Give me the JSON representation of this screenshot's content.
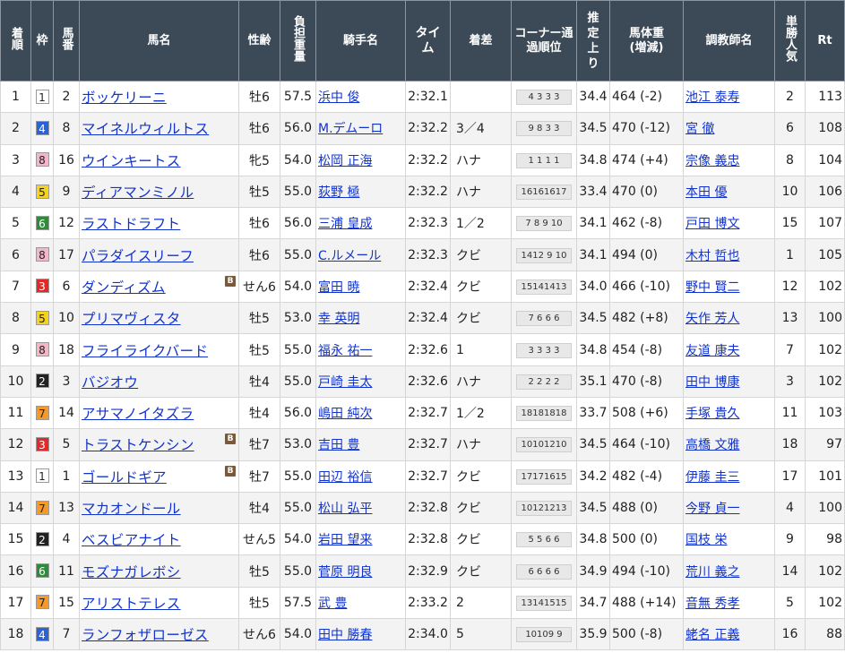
{
  "headers": {
    "rank": "着順",
    "waku": "枠",
    "umaban": "馬番",
    "horse": "馬名",
    "sexage": "性齢",
    "weight": "負担重量",
    "jockey": "騎手名",
    "time": "タイム",
    "margin": "着差",
    "corner": "コーナー通過順位",
    "last3f": "推定上り",
    "body": "馬体重(増減)",
    "trainer": "調教師名",
    "pop": "単勝人気",
    "rt": "Rt"
  },
  "blinker_label": "B",
  "waku_colors": {
    "1": {
      "bg": "#ffffff",
      "fg": "#222222"
    },
    "2": {
      "bg": "#222222",
      "fg": "#ffffff"
    },
    "3": {
      "bg": "#e02a2a",
      "fg": "#ffffff"
    },
    "4": {
      "bg": "#2a62d8",
      "fg": "#ffffff"
    },
    "5": {
      "bg": "#f5d21c",
      "fg": "#222222"
    },
    "6": {
      "bg": "#2e8b3a",
      "fg": "#ffffff"
    },
    "7": {
      "bg": "#f59a2a",
      "fg": "#222222"
    },
    "8": {
      "bg": "#f7b6c8",
      "fg": "#222222"
    }
  },
  "rows": [
    {
      "rank": "1",
      "waku": "1",
      "umaban": "2",
      "horse": "ボッケリーニ",
      "blinker": false,
      "sexage": "牡6",
      "weight": "57.5",
      "jockey": "浜中 俊",
      "time": "2:32.1",
      "margin": "",
      "corner": "4 3 3 3",
      "last3f": "34.4",
      "body": "464 (-2)",
      "trainer": "池江 泰寿",
      "pop": "2",
      "rt": "113"
    },
    {
      "rank": "2",
      "waku": "4",
      "umaban": "8",
      "horse": "マイネルウィルトス",
      "blinker": false,
      "sexage": "牡6",
      "weight": "56.0",
      "jockey": "M.デムーロ",
      "time": "2:32.2",
      "margin": "3／4",
      "corner": "9 8 3 3",
      "last3f": "34.5",
      "body": "470 (-12)",
      "trainer": "宮 徹",
      "pop": "6",
      "rt": "108"
    },
    {
      "rank": "3",
      "waku": "8",
      "umaban": "16",
      "horse": "ウインキートス",
      "blinker": false,
      "sexage": "牝5",
      "weight": "54.0",
      "jockey": "松岡 正海",
      "time": "2:32.2",
      "margin": "ハナ",
      "corner": "1 1 1 1",
      "last3f": "34.8",
      "body": "474 (+4)",
      "trainer": "宗像 義忠",
      "pop": "8",
      "rt": "104"
    },
    {
      "rank": "4",
      "waku": "5",
      "umaban": "9",
      "horse": "ディアマンミノル",
      "blinker": false,
      "sexage": "牡5",
      "weight": "55.0",
      "jockey": "荻野 極",
      "time": "2:32.2",
      "margin": "ハナ",
      "corner": "16161617",
      "last3f": "33.4",
      "body": "470 (0)",
      "trainer": "本田 優",
      "pop": "10",
      "rt": "106"
    },
    {
      "rank": "5",
      "waku": "6",
      "umaban": "12",
      "horse": "ラストドラフト",
      "blinker": false,
      "sexage": "牡6",
      "weight": "56.0",
      "jockey": "三浦 皇成",
      "time": "2:32.3",
      "margin": "1／2",
      "corner": "7 8 9 10",
      "last3f": "34.1",
      "body": "462 (-8)",
      "trainer": "戸田 博文",
      "pop": "15",
      "rt": "107"
    },
    {
      "rank": "6",
      "waku": "8",
      "umaban": "17",
      "horse": "パラダイスリーフ",
      "blinker": false,
      "sexage": "牡6",
      "weight": "55.0",
      "jockey": "C.ルメール",
      "time": "2:32.3",
      "margin": "クビ",
      "corner": "1412 9 10",
      "last3f": "34.1",
      "body": "494 (0)",
      "trainer": "木村 哲也",
      "pop": "1",
      "rt": "105"
    },
    {
      "rank": "7",
      "waku": "3",
      "umaban": "6",
      "horse": "ダンディズム",
      "blinker": true,
      "sexage": "せん6",
      "weight": "54.0",
      "jockey": "富田 暁",
      "time": "2:32.4",
      "margin": "クビ",
      "corner": "15141413",
      "last3f": "34.0",
      "body": "466 (-10)",
      "trainer": "野中 賢二",
      "pop": "12",
      "rt": "102"
    },
    {
      "rank": "8",
      "waku": "5",
      "umaban": "10",
      "horse": "プリマヴィスタ",
      "blinker": false,
      "sexage": "牡5",
      "weight": "53.0",
      "jockey": "幸 英明",
      "time": "2:32.4",
      "margin": "クビ",
      "corner": "7 6 6 6",
      "last3f": "34.5",
      "body": "482 (+8)",
      "trainer": "矢作 芳人",
      "pop": "13",
      "rt": "100"
    },
    {
      "rank": "9",
      "waku": "8",
      "umaban": "18",
      "horse": "フライライクバード",
      "blinker": false,
      "sexage": "牡5",
      "weight": "55.0",
      "jockey": "福永 祐一",
      "time": "2:32.6",
      "margin": "1",
      "corner": "3 3 3 3",
      "last3f": "34.8",
      "body": "454 (-8)",
      "trainer": "友道 康夫",
      "pop": "7",
      "rt": "102"
    },
    {
      "rank": "10",
      "waku": "2",
      "umaban": "3",
      "horse": "バジオウ",
      "blinker": false,
      "sexage": "牡4",
      "weight": "55.0",
      "jockey": "戸崎 圭太",
      "time": "2:32.6",
      "margin": "ハナ",
      "corner": "2 2 2 2",
      "last3f": "35.1",
      "body": "470 (-8)",
      "trainer": "田中 博康",
      "pop": "3",
      "rt": "102"
    },
    {
      "rank": "11",
      "waku": "7",
      "umaban": "14",
      "horse": "アサマノイタズラ",
      "blinker": false,
      "sexage": "牡4",
      "weight": "56.0",
      "jockey": "嶋田 純次",
      "time": "2:32.7",
      "margin": "1／2",
      "corner": "18181818",
      "last3f": "33.7",
      "body": "508 (+6)",
      "trainer": "手塚 貴久",
      "pop": "11",
      "rt": "103"
    },
    {
      "rank": "12",
      "waku": "3",
      "umaban": "5",
      "horse": "トラストケンシン",
      "blinker": true,
      "sexage": "牡7",
      "weight": "53.0",
      "jockey": "吉田 豊",
      "time": "2:32.7",
      "margin": "ハナ",
      "corner": "10101210",
      "last3f": "34.5",
      "body": "464 (-10)",
      "trainer": "高橋 文雅",
      "pop": "18",
      "rt": "97"
    },
    {
      "rank": "13",
      "waku": "1",
      "umaban": "1",
      "horse": "ゴールドギア",
      "blinker": true,
      "sexage": "牡7",
      "weight": "55.0",
      "jockey": "田辺 裕信",
      "time": "2:32.7",
      "margin": "クビ",
      "corner": "17171615",
      "last3f": "34.2",
      "body": "482 (-4)",
      "trainer": "伊藤 圭三",
      "pop": "17",
      "rt": "101"
    },
    {
      "rank": "14",
      "waku": "7",
      "umaban": "13",
      "horse": "マカオンドール",
      "blinker": false,
      "sexage": "牡4",
      "weight": "55.0",
      "jockey": "松山 弘平",
      "time": "2:32.8",
      "margin": "クビ",
      "corner": "10121213",
      "last3f": "34.5",
      "body": "488 (0)",
      "trainer": "今野 貞一",
      "pop": "4",
      "rt": "100"
    },
    {
      "rank": "15",
      "waku": "2",
      "umaban": "4",
      "horse": "ベスビアナイト",
      "blinker": false,
      "sexage": "せん5",
      "weight": "54.0",
      "jockey": "岩田 望来",
      "time": "2:32.8",
      "margin": "クビ",
      "corner": "5 5 6 6",
      "last3f": "34.8",
      "body": "500 (0)",
      "trainer": "国枝 栄",
      "pop": "9",
      "rt": "98"
    },
    {
      "rank": "16",
      "waku": "6",
      "umaban": "11",
      "horse": "モズナガレボシ",
      "blinker": false,
      "sexage": "牡5",
      "weight": "55.0",
      "jockey": "菅原 明良",
      "time": "2:32.9",
      "margin": "クビ",
      "corner": "6 6 6 6",
      "last3f": "34.9",
      "body": "494 (-10)",
      "trainer": "荒川 義之",
      "pop": "14",
      "rt": "102"
    },
    {
      "rank": "17",
      "waku": "7",
      "umaban": "15",
      "horse": "アリストテレス",
      "blinker": false,
      "sexage": "牡5",
      "weight": "57.5",
      "jockey": "武 豊",
      "time": "2:33.2",
      "margin": "2",
      "corner": "13141515",
      "last3f": "34.7",
      "body": "488 (+14)",
      "trainer": "音無 秀孝",
      "pop": "5",
      "rt": "102"
    },
    {
      "rank": "18",
      "waku": "4",
      "umaban": "7",
      "horse": "ランフォザローゼス",
      "blinker": false,
      "sexage": "せん6",
      "weight": "54.0",
      "jockey": "田中 勝春",
      "time": "2:34.0",
      "margin": "5",
      "corner": "10109 9",
      "last3f": "35.9",
      "body": "500 (-8)",
      "trainer": "蛯名 正義",
      "pop": "16",
      "rt": "88"
    }
  ]
}
